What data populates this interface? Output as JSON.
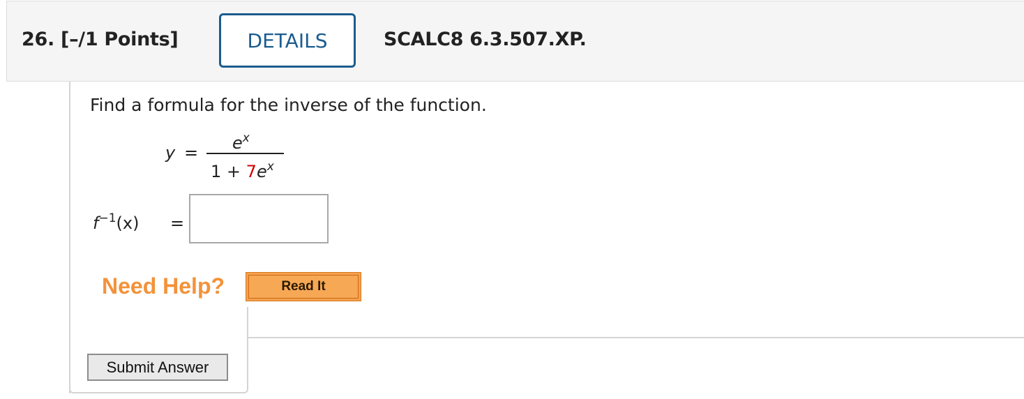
{
  "header": {
    "question_number": "26.",
    "points": "[–/1 Points]",
    "details_label": "DETAILS",
    "reference": "SCALC8 6.3.507.XP."
  },
  "problem": {
    "prompt": "Find a formula for the inverse of the function.",
    "y_var": "y",
    "equals": "=",
    "numerator_base": "e",
    "numerator_exp": "x",
    "denom_one": "1 +",
    "denom_coeff": "7",
    "denom_base": "e",
    "denom_exp": "x",
    "finv_f": "f",
    "finv_sup": "−1",
    "finv_arg": "(x)",
    "finv_equals": "="
  },
  "answer": {
    "value": "",
    "placeholder": ""
  },
  "help": {
    "label": "Need Help?",
    "read_it_label": "Read It"
  },
  "footer": {
    "submit_label": "Submit Answer"
  },
  "colors": {
    "accent_blue": "#1b5c8f",
    "help_orange": "#f3923a",
    "read_it_orange": "#f6a04d",
    "coefficient_red": "#d00000"
  }
}
